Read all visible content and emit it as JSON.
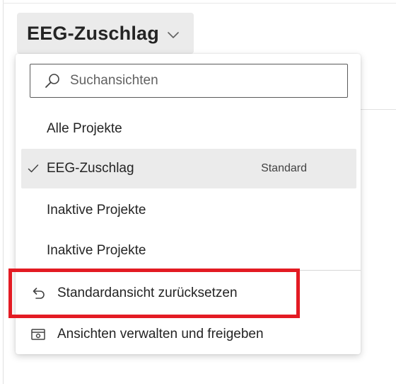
{
  "view_selector": {
    "label": "EEG-Zuschlag",
    "chevron_icon": "chevron-down-icon"
  },
  "dropdown": {
    "search": {
      "placeholder": "Suchansichten",
      "value": "",
      "icon": "search-icon"
    },
    "views": [
      {
        "label": "Alle Projekte",
        "selected": false,
        "badge": ""
      },
      {
        "label": "EEG-Zuschlag",
        "selected": true,
        "badge": "Standard"
      },
      {
        "label": "Inaktive Projekte",
        "selected": false,
        "badge": ""
      },
      {
        "label": "Inaktive Projekte",
        "selected": false,
        "badge": ""
      }
    ],
    "actions": [
      {
        "label": "Standardansicht zurücksetzen",
        "icon": "undo-icon"
      },
      {
        "label": "Ansichten verwalten und freigeben",
        "icon": "manage-views-icon"
      }
    ]
  },
  "annotation": {
    "highlight_color": "#e31b23"
  },
  "colors": {
    "selected_background": "#ebebeb",
    "text": "#242424"
  }
}
